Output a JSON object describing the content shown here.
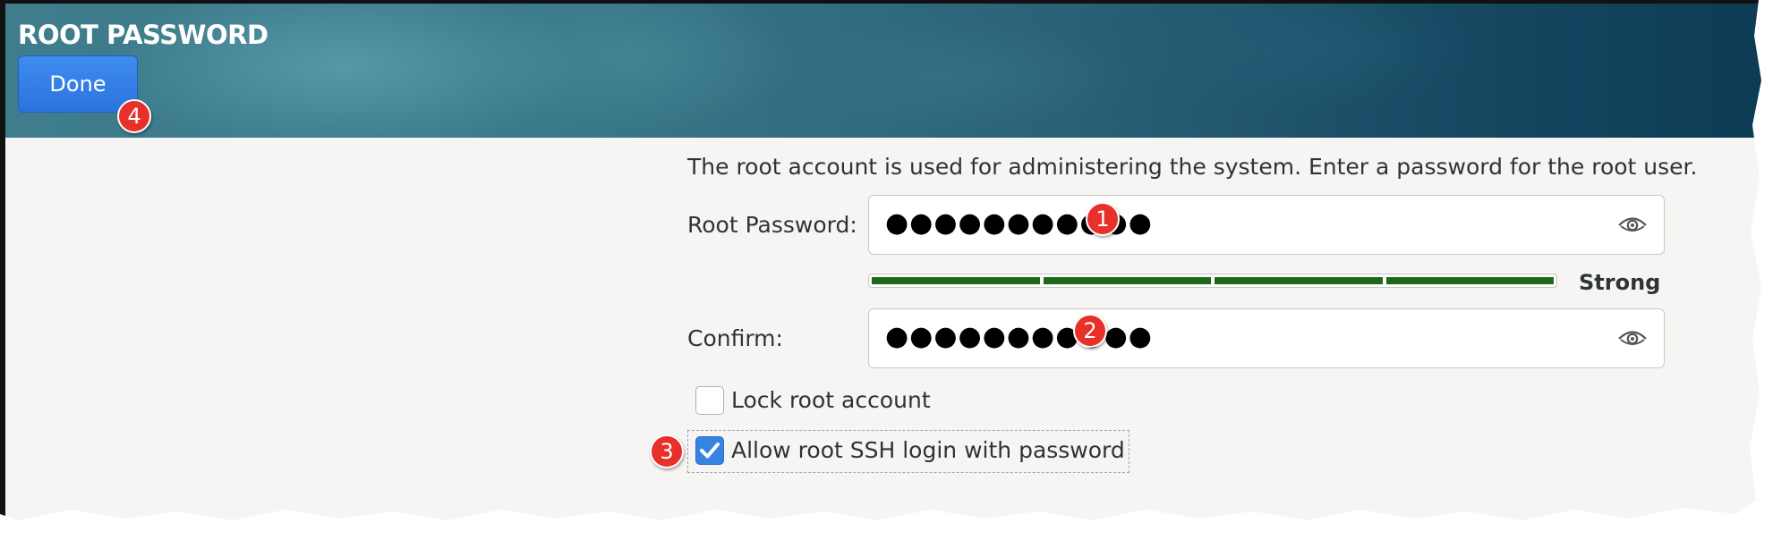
{
  "header": {
    "title": "ROOT PASSWORD",
    "done_label": "Done"
  },
  "description": "The root account is used for administering the system.  Enter a password for the root user.",
  "root_password": {
    "label": "Root Password:",
    "masked_value": "●●●●●●●●●●●",
    "reveal_icon": "eye-icon"
  },
  "strength": {
    "label": "Strong",
    "level_fraction": 1.0,
    "color": "#1a6a1a"
  },
  "confirm": {
    "label": "Confirm:",
    "masked_value": "●●●●●●●●●●●",
    "reveal_icon": "eye-icon"
  },
  "options": {
    "lock_root": {
      "label": "Lock root account",
      "checked": false
    },
    "allow_ssh": {
      "label": "Allow root SSH login with password",
      "checked": true
    }
  },
  "callouts": [
    "1",
    "2",
    "3",
    "4"
  ],
  "colors": {
    "accent": "#3584e4",
    "callout": "#e8302a",
    "done_button": "#2a73dd"
  }
}
